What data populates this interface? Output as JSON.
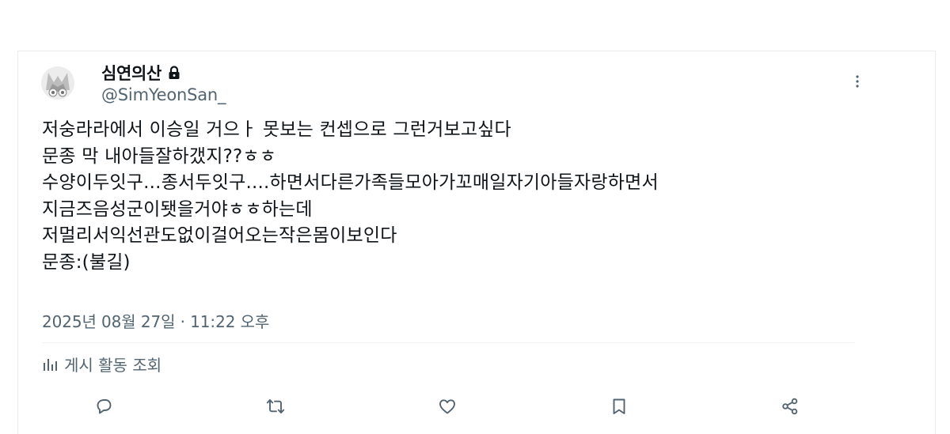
{
  "author": {
    "display_name": "심연의산",
    "handle": "@SimYeonSan_",
    "protected_icon": "lock-icon",
    "avatar": "avatar"
  },
  "tweet": {
    "lines": [
      "저숭라라에서 이승일 거으ㅏ 못보는 컨셉으로 그런거보고싶다",
      "문종 막 내아들잘하갰지??ㅎㅎ",
      "수양이두잇구...종서두잇구....하면서다른가족들모아가꼬매일자기아들자랑하면서",
      "지금즈음성군이됏을거야ㅎㅎ하는데",
      "저멀리서익선관도없이걸어오는작은몸이보인다",
      "문종:(불길)"
    ],
    "timestamp": "2025년 08월 27일 · 11:22 오후"
  },
  "activity": {
    "label": "게시 활동 조회",
    "icon": "analytics-icon"
  },
  "actions": [
    {
      "name": "reply",
      "icon": "reply-icon"
    },
    {
      "name": "repost",
      "icon": "repost-icon"
    },
    {
      "name": "like",
      "icon": "heart-icon"
    },
    {
      "name": "bookmark",
      "icon": "bookmark-icon"
    },
    {
      "name": "share",
      "icon": "share-icon"
    }
  ],
  "colors": {
    "text": "#0f1419",
    "secondary": "#536471",
    "border": "#eff3f4"
  }
}
